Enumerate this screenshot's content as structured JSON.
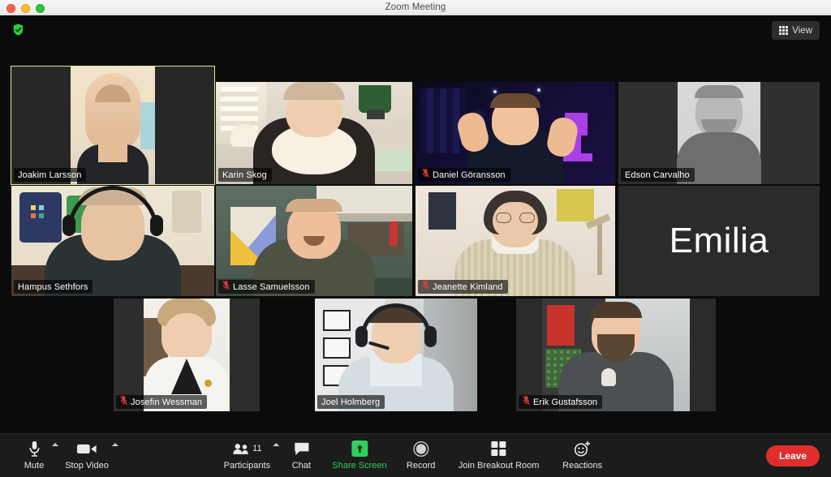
{
  "window": {
    "title": "Zoom Meeting",
    "traffic_lights": [
      "close",
      "minimize",
      "maximize"
    ]
  },
  "stage": {
    "encryption_icon": "shield-check-icon",
    "view_button": {
      "label": "View",
      "icon": "grid-icon"
    },
    "active_speaker_color": "#d9ee8d",
    "background_color": "#0b0b0b"
  },
  "participants": [
    {
      "name": "Joakim Larsson",
      "muted": false,
      "video": true,
      "active_speaker": true,
      "row": 1,
      "col": 1
    },
    {
      "name": "Karin Skog",
      "muted": false,
      "video": true,
      "active_speaker": false,
      "row": 1,
      "col": 2
    },
    {
      "name": "Daniel Göransson",
      "muted": true,
      "video": true,
      "active_speaker": false,
      "row": 1,
      "col": 3
    },
    {
      "name": "Edson Carvalho",
      "muted": false,
      "video": true,
      "active_speaker": false,
      "row": 1,
      "col": 4
    },
    {
      "name": "Hampus Sethfors",
      "muted": false,
      "video": true,
      "active_speaker": false,
      "row": 2,
      "col": 1
    },
    {
      "name": "Lasse Samuelsson",
      "muted": true,
      "video": true,
      "active_speaker": false,
      "row": 2,
      "col": 2
    },
    {
      "name": "Jeanette Kimland",
      "muted": true,
      "video": true,
      "active_speaker": false,
      "row": 2,
      "col": 3
    },
    {
      "name": "Emilia",
      "muted": false,
      "video": false,
      "active_speaker": false,
      "row": 2,
      "col": 4
    },
    {
      "name": "Josefin Wessman",
      "muted": true,
      "video": true,
      "active_speaker": false,
      "row": 3,
      "col": 1
    },
    {
      "name": "Joel Holmberg",
      "muted": false,
      "video": true,
      "active_speaker": false,
      "row": 3,
      "col": 2
    },
    {
      "name": "Erik Gustafsson",
      "muted": true,
      "video": true,
      "active_speaker": false,
      "row": 3,
      "col": 3
    }
  ],
  "toolbar": {
    "mute": {
      "label": "Mute",
      "icon": "microphone-icon",
      "has_chevron": true
    },
    "stop_video": {
      "label": "Stop Video",
      "icon": "video-camera-icon",
      "has_chevron": true
    },
    "participants": {
      "label": "Participants",
      "icon": "people-icon",
      "count": "11",
      "has_chevron": true
    },
    "chat": {
      "label": "Chat",
      "icon": "speech-bubble-icon"
    },
    "share": {
      "label": "Share Screen",
      "icon": "upload-arrow-icon",
      "color": "#31d05a"
    },
    "record": {
      "label": "Record",
      "icon": "record-circle-icon"
    },
    "breakout": {
      "label": "Join Breakout Room",
      "icon": "four-squares-icon"
    },
    "reactions": {
      "label": "Reactions",
      "icon": "smiley-plus-icon"
    },
    "leave": {
      "label": "Leave",
      "color": "#e02d2d"
    }
  }
}
